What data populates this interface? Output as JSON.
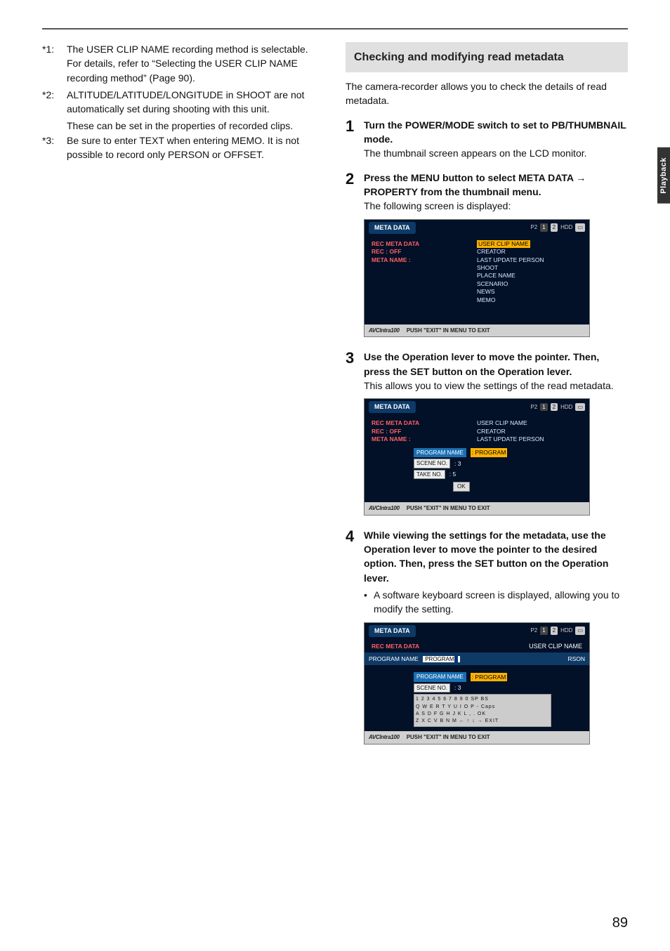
{
  "side_tab": "Playback",
  "page_number": "89",
  "left": {
    "n1": {
      "key": "*1:",
      "p1": "The USER CLIP NAME recording method is selectable. For details, refer to “Selecting the USER CLIP NAME recording method” (Page 90)."
    },
    "n2": {
      "key": "*2:",
      "p1": "ALTITUDE/LATITUDE/LONGITUDE in SHOOT are not automatically set during shooting with this unit.",
      "p2": "These can be set in the properties of recorded clips."
    },
    "n3": {
      "key": "*3:",
      "p1": "Be sure to enter TEXT when entering MEMO. It is not possible to record only PERSON or OFFSET."
    }
  },
  "right": {
    "section_title": "Checking and modifying read metadata",
    "intro": "The camera-recorder allows you to check the details of read metadata.",
    "s1": {
      "num": "1",
      "head": "Turn the POWER/MODE switch to set to PB/THUMBNAIL mode.",
      "body": "The thumbnail screen appears on the LCD monitor."
    },
    "s2": {
      "num": "2",
      "head": "Press the MENU button to select META DATA → PROPERTY from the thumbnail menu.",
      "body": "The following screen is displayed:"
    },
    "s3": {
      "num": "3",
      "head": "Use the Operation lever to move the pointer. Then, press the SET button on the Operation lever.",
      "body": "This allows you to view the settings of the read metadata."
    },
    "s4": {
      "num": "4",
      "head": "While viewing the settings for the metadata, use the Operation lever to move the pointer to the desired option. Then, press the SET button on the Operation lever.",
      "bullet": "A software keyboard screen is displayed, allowing you to modify the setting."
    }
  },
  "shot": {
    "top_label": "META DATA",
    "p2": "P2",
    "b1": "1",
    "b2": "2",
    "hdd": "HDD",
    "left_l1": "REC META DATA",
    "left_l2": "REC : OFF",
    "left_l3": "META NAME :",
    "r1_usr": "USER CLIP NAME",
    "r1_cre": "CREATOR",
    "r1_lup": "LAST UPDATE PERSON",
    "r1_sho": "SHOOT",
    "r1_pla": "PLACE NAME",
    "r1_sce": "SCENARIO",
    "r1_new": "NEWS",
    "r1_mem": "MEMO",
    "brand": "AVCIntra100",
    "foot": "PUSH \"EXIT\" IN MENU TO EXIT",
    "prog_lbl": "PROGRAM NAME",
    "scene_lbl": "SCENE NO.",
    "take_lbl": "TAKE NO.",
    "prog_val": ":  PROGRAM",
    "scene_val": ":  3",
    "take_val": ":  5",
    "ok": "OK",
    "edit_lbl": "PROGRAM NAME",
    "edit_val": "PROGRAM",
    "rson": "RSON",
    "k_row1": "1 2 3 4 5 6 7 8 9 0 SP BS",
    "k_row2": "Q W E R T Y U I O P - Caps",
    "k_row3": "A S D F G H J K L , . OK",
    "k_row4": "Z X C V B N M ← ↑ ↓ → EXIT"
  }
}
